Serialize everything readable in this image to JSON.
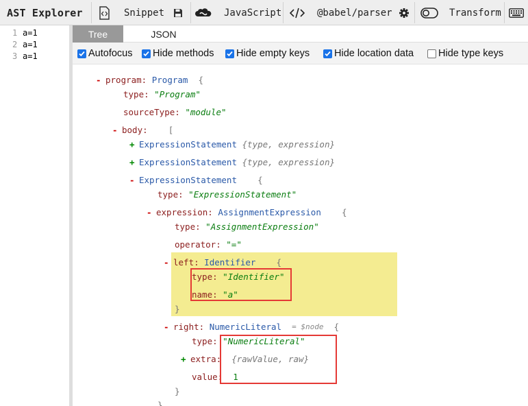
{
  "toolbar": {
    "brand": "AST Explorer",
    "snippet_label": "Snippet",
    "language_label": "JavaScript",
    "parser_label": "@babel/parser",
    "transform_label": "Transform"
  },
  "editor": {
    "lines": [
      {
        "num": "1",
        "code": "a=1"
      },
      {
        "num": "2",
        "code": "a=1"
      },
      {
        "num": "3",
        "code": "a=1"
      }
    ]
  },
  "tabs": [
    {
      "label": "Tree",
      "active": true
    },
    {
      "label": "JSON",
      "active": false
    }
  ],
  "options": [
    {
      "label": "Autofocus",
      "checked": true
    },
    {
      "label": "Hide methods",
      "checked": true
    },
    {
      "label": "Hide empty keys",
      "checked": true
    },
    {
      "label": "Hide location data",
      "checked": true
    },
    {
      "label": "Hide type keys",
      "checked": false
    }
  ],
  "tree": {
    "program_key": "program:",
    "program_type": "Program",
    "type_key": "type:",
    "program_type_value": "\"Program\"",
    "sourcetype_key": "sourceType:",
    "sourcetype_value": "\"module\"",
    "body_key": "body:",
    "collapsed_stmt_1": "ExpressionStatement",
    "collapsed_stmt_1_keys": "{type, expression}",
    "collapsed_stmt_2": "ExpressionStatement",
    "collapsed_stmt_2_keys": "{type, expression}",
    "expanded_stmt": "ExpressionStatement",
    "expanded_stmt_type_value": "\"ExpressionStatement\"",
    "expression_key": "expression:",
    "expression_type": "AssignmentExpression",
    "expression_type_value": "\"AssignmentExpression\"",
    "operator_key": "operator:",
    "operator_value": "\"=\"",
    "left_key": "left:",
    "left_type": "Identifier",
    "left_type_value": "\"Identifier\"",
    "name_key": "name:",
    "name_value": "\"a\"",
    "right_key": "right:",
    "right_type": "NumericLiteral",
    "right_node_label": "= $node",
    "right_type_value": "\"NumericLiteral\"",
    "extra_key": "extra:",
    "extra_keys": "{rawValue, raw}",
    "value_key": "value:",
    "value_value": "1",
    "open_brace": "{",
    "close_brace": "}",
    "open_bracket": "["
  },
  "colors": {
    "highlight": "#f4ec91",
    "annotation_box": "#e53935",
    "active_tab": "#999999",
    "checkbox": "#1a73e8"
  }
}
